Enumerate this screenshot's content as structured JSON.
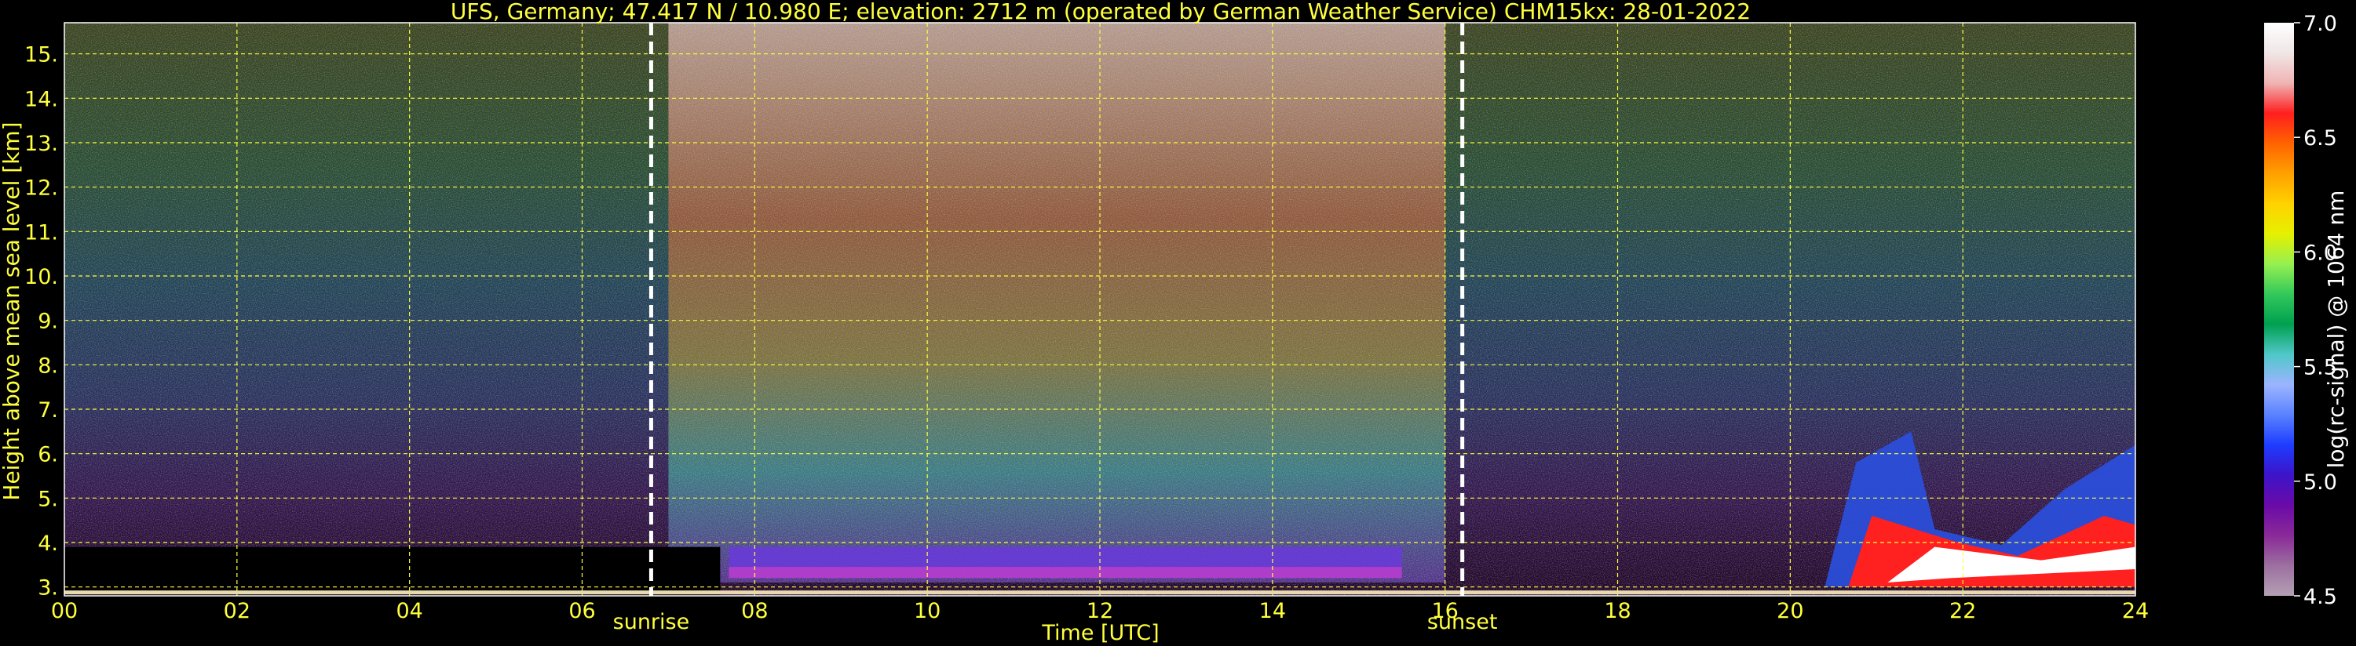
{
  "chart_data": {
    "type": "heatmap",
    "title": "UFS, Germany; 47.417 N / 10.980 E; elevation: 2712 m  (operated by German Weather Service)    CHM15kx: 28-01-2022",
    "xlabel": "Time [UTC]",
    "ylabel": "Height above mean sea level [km]",
    "xlim": [
      0,
      24
    ],
    "ylim": [
      2.8,
      15.7
    ],
    "x_ticks": [
      "00",
      "02",
      "04",
      "06",
      "08",
      "10",
      "12",
      "14",
      "16",
      "18",
      "20",
      "22",
      "24"
    ],
    "y_ticks": [
      "3.",
      "4.",
      "5.",
      "6.",
      "7.",
      "8.",
      "9.",
      "10.",
      "11.",
      "12.",
      "13.",
      "14.",
      "15."
    ],
    "grid": true,
    "annotations": [
      {
        "label": "sunrise",
        "x": 6.8
      },
      {
        "label": "sunset",
        "x": 16.2
      }
    ],
    "colorbar": {
      "label": "log(rc-signal) @ 1064 nm",
      "range": [
        4.5,
        7.0
      ],
      "ticks": [
        "4.5",
        "5.0",
        "5.5",
        "6.0",
        "6.5",
        "7.0"
      ]
    },
    "features": [
      {
        "type": "noise-band",
        "x": [
          7.7,
          15.5
        ],
        "y": [
          3.2,
          3.9
        ]
      },
      {
        "type": "cloud-layer",
        "x": [
          20.4,
          24
        ],
        "y": [
          3.0,
          6.6
        ]
      }
    ]
  },
  "colors": {
    "text": "#ffff3c",
    "grid": "#ffff3c",
    "background": "#000000",
    "colorbar_stops": [
      "#b4a0b4",
      "#9c6fa0",
      "#8a2a98",
      "#6a0aa8",
      "#3c14c8",
      "#1e3cff",
      "#5a82ff",
      "#9cb4ff",
      "#50c8c8",
      "#00a050",
      "#32c85a",
      "#96f050",
      "#e6f000",
      "#ffd200",
      "#ffa000",
      "#ff6400",
      "#ff1e1e",
      "#f0b4b4",
      "#f0e6e6",
      "#ffffff"
    ]
  }
}
